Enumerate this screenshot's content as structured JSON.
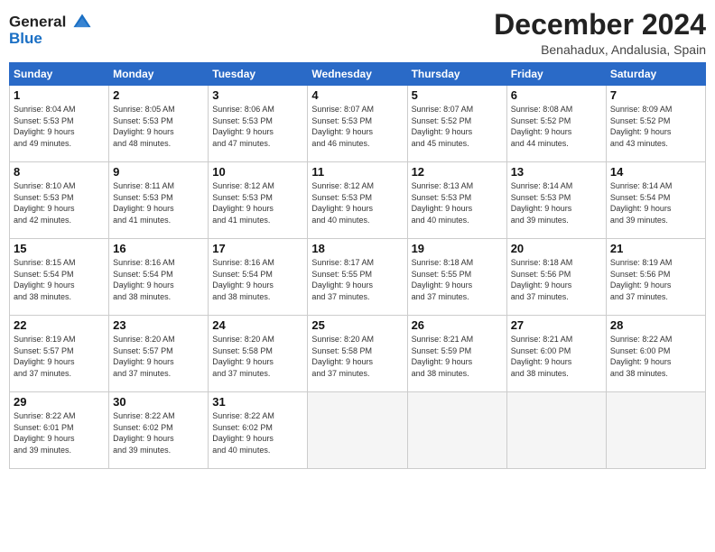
{
  "logo": {
    "general": "General",
    "blue": "Blue"
  },
  "title": "December 2024",
  "subtitle": "Benahadux, Andalusia, Spain",
  "days_header": [
    "Sunday",
    "Monday",
    "Tuesday",
    "Wednesday",
    "Thursday",
    "Friday",
    "Saturday"
  ],
  "weeks": [
    [
      {
        "day": "1",
        "lines": [
          "Sunrise: 8:04 AM",
          "Sunset: 5:53 PM",
          "Daylight: 9 hours",
          "and 49 minutes."
        ]
      },
      {
        "day": "2",
        "lines": [
          "Sunrise: 8:05 AM",
          "Sunset: 5:53 PM",
          "Daylight: 9 hours",
          "and 48 minutes."
        ]
      },
      {
        "day": "3",
        "lines": [
          "Sunrise: 8:06 AM",
          "Sunset: 5:53 PM",
          "Daylight: 9 hours",
          "and 47 minutes."
        ]
      },
      {
        "day": "4",
        "lines": [
          "Sunrise: 8:07 AM",
          "Sunset: 5:53 PM",
          "Daylight: 9 hours",
          "and 46 minutes."
        ]
      },
      {
        "day": "5",
        "lines": [
          "Sunrise: 8:07 AM",
          "Sunset: 5:52 PM",
          "Daylight: 9 hours",
          "and 45 minutes."
        ]
      },
      {
        "day": "6",
        "lines": [
          "Sunrise: 8:08 AM",
          "Sunset: 5:52 PM",
          "Daylight: 9 hours",
          "and 44 minutes."
        ]
      },
      {
        "day": "7",
        "lines": [
          "Sunrise: 8:09 AM",
          "Sunset: 5:52 PM",
          "Daylight: 9 hours",
          "and 43 minutes."
        ]
      }
    ],
    [
      {
        "day": "8",
        "lines": [
          "Sunrise: 8:10 AM",
          "Sunset: 5:53 PM",
          "Daylight: 9 hours",
          "and 42 minutes."
        ]
      },
      {
        "day": "9",
        "lines": [
          "Sunrise: 8:11 AM",
          "Sunset: 5:53 PM",
          "Daylight: 9 hours",
          "and 41 minutes."
        ]
      },
      {
        "day": "10",
        "lines": [
          "Sunrise: 8:12 AM",
          "Sunset: 5:53 PM",
          "Daylight: 9 hours",
          "and 41 minutes."
        ]
      },
      {
        "day": "11",
        "lines": [
          "Sunrise: 8:12 AM",
          "Sunset: 5:53 PM",
          "Daylight: 9 hours",
          "and 40 minutes."
        ]
      },
      {
        "day": "12",
        "lines": [
          "Sunrise: 8:13 AM",
          "Sunset: 5:53 PM",
          "Daylight: 9 hours",
          "and 40 minutes."
        ]
      },
      {
        "day": "13",
        "lines": [
          "Sunrise: 8:14 AM",
          "Sunset: 5:53 PM",
          "Daylight: 9 hours",
          "and 39 minutes."
        ]
      },
      {
        "day": "14",
        "lines": [
          "Sunrise: 8:14 AM",
          "Sunset: 5:54 PM",
          "Daylight: 9 hours",
          "and 39 minutes."
        ]
      }
    ],
    [
      {
        "day": "15",
        "lines": [
          "Sunrise: 8:15 AM",
          "Sunset: 5:54 PM",
          "Daylight: 9 hours",
          "and 38 minutes."
        ]
      },
      {
        "day": "16",
        "lines": [
          "Sunrise: 8:16 AM",
          "Sunset: 5:54 PM",
          "Daylight: 9 hours",
          "and 38 minutes."
        ]
      },
      {
        "day": "17",
        "lines": [
          "Sunrise: 8:16 AM",
          "Sunset: 5:54 PM",
          "Daylight: 9 hours",
          "and 38 minutes."
        ]
      },
      {
        "day": "18",
        "lines": [
          "Sunrise: 8:17 AM",
          "Sunset: 5:55 PM",
          "Daylight: 9 hours",
          "and 37 minutes."
        ]
      },
      {
        "day": "19",
        "lines": [
          "Sunrise: 8:18 AM",
          "Sunset: 5:55 PM",
          "Daylight: 9 hours",
          "and 37 minutes."
        ]
      },
      {
        "day": "20",
        "lines": [
          "Sunrise: 8:18 AM",
          "Sunset: 5:56 PM",
          "Daylight: 9 hours",
          "and 37 minutes."
        ]
      },
      {
        "day": "21",
        "lines": [
          "Sunrise: 8:19 AM",
          "Sunset: 5:56 PM",
          "Daylight: 9 hours",
          "and 37 minutes."
        ]
      }
    ],
    [
      {
        "day": "22",
        "lines": [
          "Sunrise: 8:19 AM",
          "Sunset: 5:57 PM",
          "Daylight: 9 hours",
          "and 37 minutes."
        ]
      },
      {
        "day": "23",
        "lines": [
          "Sunrise: 8:20 AM",
          "Sunset: 5:57 PM",
          "Daylight: 9 hours",
          "and 37 minutes."
        ]
      },
      {
        "day": "24",
        "lines": [
          "Sunrise: 8:20 AM",
          "Sunset: 5:58 PM",
          "Daylight: 9 hours",
          "and 37 minutes."
        ]
      },
      {
        "day": "25",
        "lines": [
          "Sunrise: 8:20 AM",
          "Sunset: 5:58 PM",
          "Daylight: 9 hours",
          "and 37 minutes."
        ]
      },
      {
        "day": "26",
        "lines": [
          "Sunrise: 8:21 AM",
          "Sunset: 5:59 PM",
          "Daylight: 9 hours",
          "and 38 minutes."
        ]
      },
      {
        "day": "27",
        "lines": [
          "Sunrise: 8:21 AM",
          "Sunset: 6:00 PM",
          "Daylight: 9 hours",
          "and 38 minutes."
        ]
      },
      {
        "day": "28",
        "lines": [
          "Sunrise: 8:22 AM",
          "Sunset: 6:00 PM",
          "Daylight: 9 hours",
          "and 38 minutes."
        ]
      }
    ],
    [
      {
        "day": "29",
        "lines": [
          "Sunrise: 8:22 AM",
          "Sunset: 6:01 PM",
          "Daylight: 9 hours",
          "and 39 minutes."
        ]
      },
      {
        "day": "30",
        "lines": [
          "Sunrise: 8:22 AM",
          "Sunset: 6:02 PM",
          "Daylight: 9 hours",
          "and 39 minutes."
        ]
      },
      {
        "day": "31",
        "lines": [
          "Sunrise: 8:22 AM",
          "Sunset: 6:02 PM",
          "Daylight: 9 hours",
          "and 40 minutes."
        ]
      },
      null,
      null,
      null,
      null
    ]
  ]
}
